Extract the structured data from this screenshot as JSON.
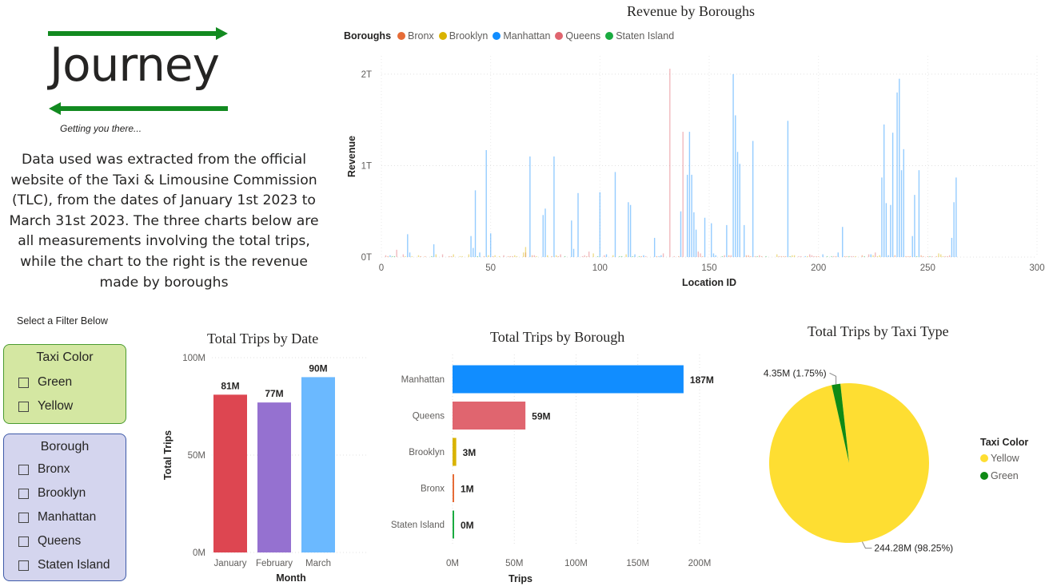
{
  "logo": {
    "wordmark": "Journey",
    "tagline": "Getting you there..."
  },
  "description": "Data used was extracted from the official website of the Taxi & Limousine Commission (TLC), from the dates of January 1st 2023 to March 31st 2023. The three charts below are all measurements involving the total trips, while the chart to the right is the revenue made by boroughs",
  "filters": {
    "heading": "Select a Filter Below",
    "taxi_color": {
      "title": "Taxi Color",
      "options": [
        "Green",
        "Yellow"
      ]
    },
    "borough": {
      "title": "Borough",
      "options": [
        "Bronx",
        "Brooklyn",
        "Manhattan",
        "Queens",
        "Staten Island"
      ]
    }
  },
  "colors": {
    "bronx": "#e66c37",
    "brooklyn": "#d9b300",
    "manhattan": "#118dff",
    "queens": "#e0656f",
    "staten_island": "#1aab40",
    "yellow": "#fede32",
    "green": "#0f8a15",
    "january": "#dd4651",
    "february": "#9571d0",
    "march": "#6bb9ff",
    "logo_arrow": "#128a20"
  },
  "chart_data": [
    {
      "id": "revenue",
      "type": "bar",
      "title": "Revenue by Boroughs",
      "legend_title": "Boroughs",
      "legend": [
        "Bronx",
        "Brooklyn",
        "Manhattan",
        "Queens",
        "Staten Island"
      ],
      "legend_placement": "top-left",
      "xlabel": "Location ID",
      "ylabel": "Revenue",
      "xlim": [
        0,
        300
      ],
      "ylim": [
        0,
        2.2
      ],
      "x_ticks": [
        "0",
        "50",
        "100",
        "150",
        "200",
        "250",
        "300"
      ],
      "y_ticks": [
        "0T",
        "1T",
        "2T"
      ],
      "grid": "dotted",
      "series": [
        {
          "name": "Manhattan",
          "points": [
            [
              4,
              0.02
            ],
            [
              12,
              0.25
            ],
            [
              13,
              0.05
            ],
            [
              24,
              0.14
            ],
            [
              41,
              0.23
            ],
            [
              42,
              0.1
            ],
            [
              43,
              0.73
            ],
            [
              45,
              0.05
            ],
            [
              48,
              1.17
            ],
            [
              50,
              0.26
            ],
            [
              68,
              1.1
            ],
            [
              74,
              0.46
            ],
            [
              75,
              0.53
            ],
            [
              79,
              1.1
            ],
            [
              87,
              0.4
            ],
            [
              88,
              0.09
            ],
            [
              90,
              0.7
            ],
            [
              100,
              0.71
            ],
            [
              103,
              0.03
            ],
            [
              107,
              0.93
            ],
            [
              113,
              0.6
            ],
            [
              114,
              0.57
            ],
            [
              116,
              0.03
            ],
            [
              120,
              0.02
            ],
            [
              125,
              0.21
            ],
            [
              127,
              0.01
            ],
            [
              128,
              0.02
            ],
            [
              137,
              0.5
            ],
            [
              140,
              0.9
            ],
            [
              141,
              1.37
            ],
            [
              142,
              0.9
            ],
            [
              143,
              0.49
            ],
            [
              144,
              0.3
            ],
            [
              148,
              0.43
            ],
            [
              151,
              0.37
            ],
            [
              152,
              0.04
            ],
            [
              153,
              0.02
            ],
            [
              158,
              0.35
            ],
            [
              161,
              2.0
            ],
            [
              162,
              1.55
            ],
            [
              163,
              1.15
            ],
            [
              164,
              1.02
            ],
            [
              166,
              0.35
            ],
            [
              170,
              1.27
            ],
            [
              186,
              1.49
            ],
            [
              194,
              0.01
            ],
            [
              202,
              0.03
            ],
            [
              209,
              0.05
            ],
            [
              211,
              0.33
            ],
            [
              224,
              0.03
            ],
            [
              229,
              0.87
            ],
            [
              230,
              1.45
            ],
            [
              231,
              0.59
            ],
            [
              232,
              0.02
            ],
            [
              233,
              0.57
            ],
            [
              234,
              1.36
            ],
            [
              236,
              1.8
            ],
            [
              237,
              1.95
            ],
            [
              238,
              0.95
            ],
            [
              239,
              1.18
            ],
            [
              243,
              0.23
            ],
            [
              244,
              0.68
            ],
            [
              246,
              0.95
            ],
            [
              261,
              0.21
            ],
            [
              262,
              0.6
            ],
            [
              263,
              0.87
            ]
          ]
        },
        {
          "name": "Queens",
          "points": [
            [
              2,
              0.02
            ],
            [
              7,
              0.08
            ],
            [
              10,
              0.03
            ],
            [
              28,
              0.03
            ],
            [
              56,
              0.02
            ],
            [
              66,
              0.05
            ],
            [
              70,
              0.02
            ],
            [
              82,
              0.03
            ],
            [
              92,
              0.01
            ],
            [
              93,
              0.02
            ],
            [
              95,
              0.06
            ],
            [
              102,
              0.02
            ],
            [
              121,
              0.01
            ],
            [
              129,
              0.04
            ],
            [
              132,
              2.06
            ],
            [
              134,
              0.01
            ],
            [
              138,
              1.37
            ],
            [
              145,
              0.06
            ],
            [
              146,
              0.04
            ],
            [
              157,
              0.02
            ],
            [
              160,
              0.02
            ],
            [
              171,
              0.01
            ],
            [
              173,
              0.02
            ],
            [
              191,
              0.01
            ],
            [
              192,
              0.01
            ],
            [
              196,
              0.03
            ],
            [
              197,
              0.02
            ],
            [
              198,
              0.01
            ],
            [
              207,
              0.01
            ],
            [
              215,
              0.01
            ],
            [
              216,
              0.01
            ],
            [
              223,
              0.03
            ],
            [
              226,
              0.05
            ],
            [
              252,
              0.01
            ],
            [
              258,
              0.01
            ],
            [
              260,
              0.02
            ]
          ]
        },
        {
          "name": "Brooklyn",
          "points": [
            [
              11,
              0.01
            ],
            [
              14,
              0.01
            ],
            [
              17,
              0.02
            ],
            [
              25,
              0.03
            ],
            [
              33,
              0.03
            ],
            [
              36,
              0.01
            ],
            [
              37,
              0.01
            ],
            [
              40,
              0.03
            ],
            [
              49,
              0.02
            ],
            [
              52,
              0.02
            ],
            [
              54,
              0.01
            ],
            [
              61,
              0.02
            ],
            [
              62,
              0.01
            ],
            [
              65,
              0.05
            ],
            [
              66,
              0.11
            ],
            [
              71,
              0.01
            ],
            [
              76,
              0.02
            ],
            [
              80,
              0.02
            ],
            [
              97,
              0.04
            ],
            [
              106,
              0.02
            ],
            [
              112,
              0.03
            ],
            [
              181,
              0.03
            ],
            [
              188,
              0.02
            ],
            [
              189,
              0.02
            ],
            [
              195,
              0.01
            ],
            [
              217,
              0.01
            ],
            [
              225,
              0.02
            ],
            [
              227,
              0.01
            ],
            [
              228,
              0.02
            ],
            [
              255,
              0.04
            ],
            [
              256,
              0.03
            ],
            [
              257,
              0.01
            ]
          ]
        },
        {
          "name": "Bronx",
          "points": [
            [
              3,
              0.01
            ],
            [
              18,
              0.01
            ],
            [
              20,
              0.01
            ],
            [
              31,
              0.01
            ],
            [
              32,
              0.01
            ],
            [
              47,
              0.01
            ],
            [
              51,
              0.01
            ],
            [
              58,
              0.01
            ],
            [
              59,
              0.01
            ],
            [
              60,
              0.01
            ],
            [
              69,
              0.02
            ],
            [
              78,
              0.01
            ],
            [
              81,
              0.01
            ],
            [
              94,
              0.01
            ],
            [
              119,
              0.01
            ],
            [
              126,
              0.01
            ],
            [
              136,
              0.01
            ],
            [
              147,
              0.01
            ],
            [
              159,
              0.02
            ],
            [
              167,
              0.02
            ],
            [
              168,
              0.02
            ],
            [
              169,
              0.01
            ],
            [
              174,
              0.01
            ],
            [
              182,
              0.01
            ],
            [
              183,
              0.01
            ],
            [
              184,
              0.01
            ],
            [
              185,
              0.01
            ],
            [
              199,
              0.01
            ],
            [
              200,
              0.01
            ],
            [
              208,
              0.01
            ],
            [
              212,
              0.01
            ],
            [
              213,
              0.01
            ],
            [
              220,
              0.02
            ],
            [
              235,
              0.02
            ],
            [
              240,
              0.01
            ],
            [
              241,
              0.01
            ],
            [
              242,
              0.01
            ],
            [
              247,
              0.02
            ],
            [
              248,
              0.01
            ],
            [
              250,
              0.01
            ],
            [
              254,
              0.01
            ],
            [
              259,
              0.01
            ]
          ]
        },
        {
          "name": "Staten Island",
          "points": [
            [
              5,
              0.01
            ],
            [
              6,
              0.01
            ],
            [
              23,
              0.01
            ],
            [
              44,
              0.01
            ],
            [
              84,
              0.01
            ],
            [
              99,
              0.01
            ],
            [
              109,
              0.01
            ],
            [
              110,
              0.01
            ],
            [
              115,
              0.01
            ],
            [
              118,
              0.01
            ],
            [
              156,
              0.01
            ],
            [
              172,
              0.01
            ],
            [
              176,
              0.01
            ],
            [
              187,
              0.01
            ],
            [
              204,
              0.01
            ],
            [
              206,
              0.01
            ],
            [
              214,
              0.01
            ],
            [
              221,
              0.01
            ],
            [
              245,
              0.01
            ],
            [
              251,
              0.01
            ]
          ]
        }
      ]
    },
    {
      "id": "by-date",
      "type": "bar",
      "title": "Total Trips by Date",
      "xlabel": "Month",
      "ylabel": "Total Trips",
      "categories": [
        "January",
        "February",
        "March"
      ],
      "values": [
        81,
        77,
        90
      ],
      "data_labels": [
        "81M",
        "77M",
        "90M"
      ],
      "ylim": [
        0,
        100
      ],
      "y_ticks": [
        "0M",
        "50M",
        "100M"
      ],
      "grid": "dotted"
    },
    {
      "id": "by-borough",
      "type": "bar",
      "orientation": "horizontal",
      "title": "Total Trips by Borough",
      "xlabel": "Trips",
      "ylabel": "",
      "categories": [
        "Manhattan",
        "Queens",
        "Brooklyn",
        "Bronx",
        "Staten Island"
      ],
      "values": [
        187,
        59,
        3,
        1,
        0
      ],
      "data_labels": [
        "187M",
        "59M",
        "3M",
        "1M",
        "0M"
      ],
      "xlim": [
        0,
        200
      ],
      "x_ticks": [
        "0M",
        "50M",
        "100M",
        "150M",
        "200M"
      ],
      "grid": "dotted"
    },
    {
      "id": "by-taxi",
      "type": "pie",
      "title": "Total Trips by Taxi Type",
      "legend_title": "Taxi Color",
      "legend_placement": "right",
      "categories": [
        "Yellow",
        "Green"
      ],
      "values": [
        244.28,
        4.35
      ],
      "data_labels": [
        "244.28M (98.25%)",
        "4.35M (1.75%)"
      ]
    }
  ]
}
